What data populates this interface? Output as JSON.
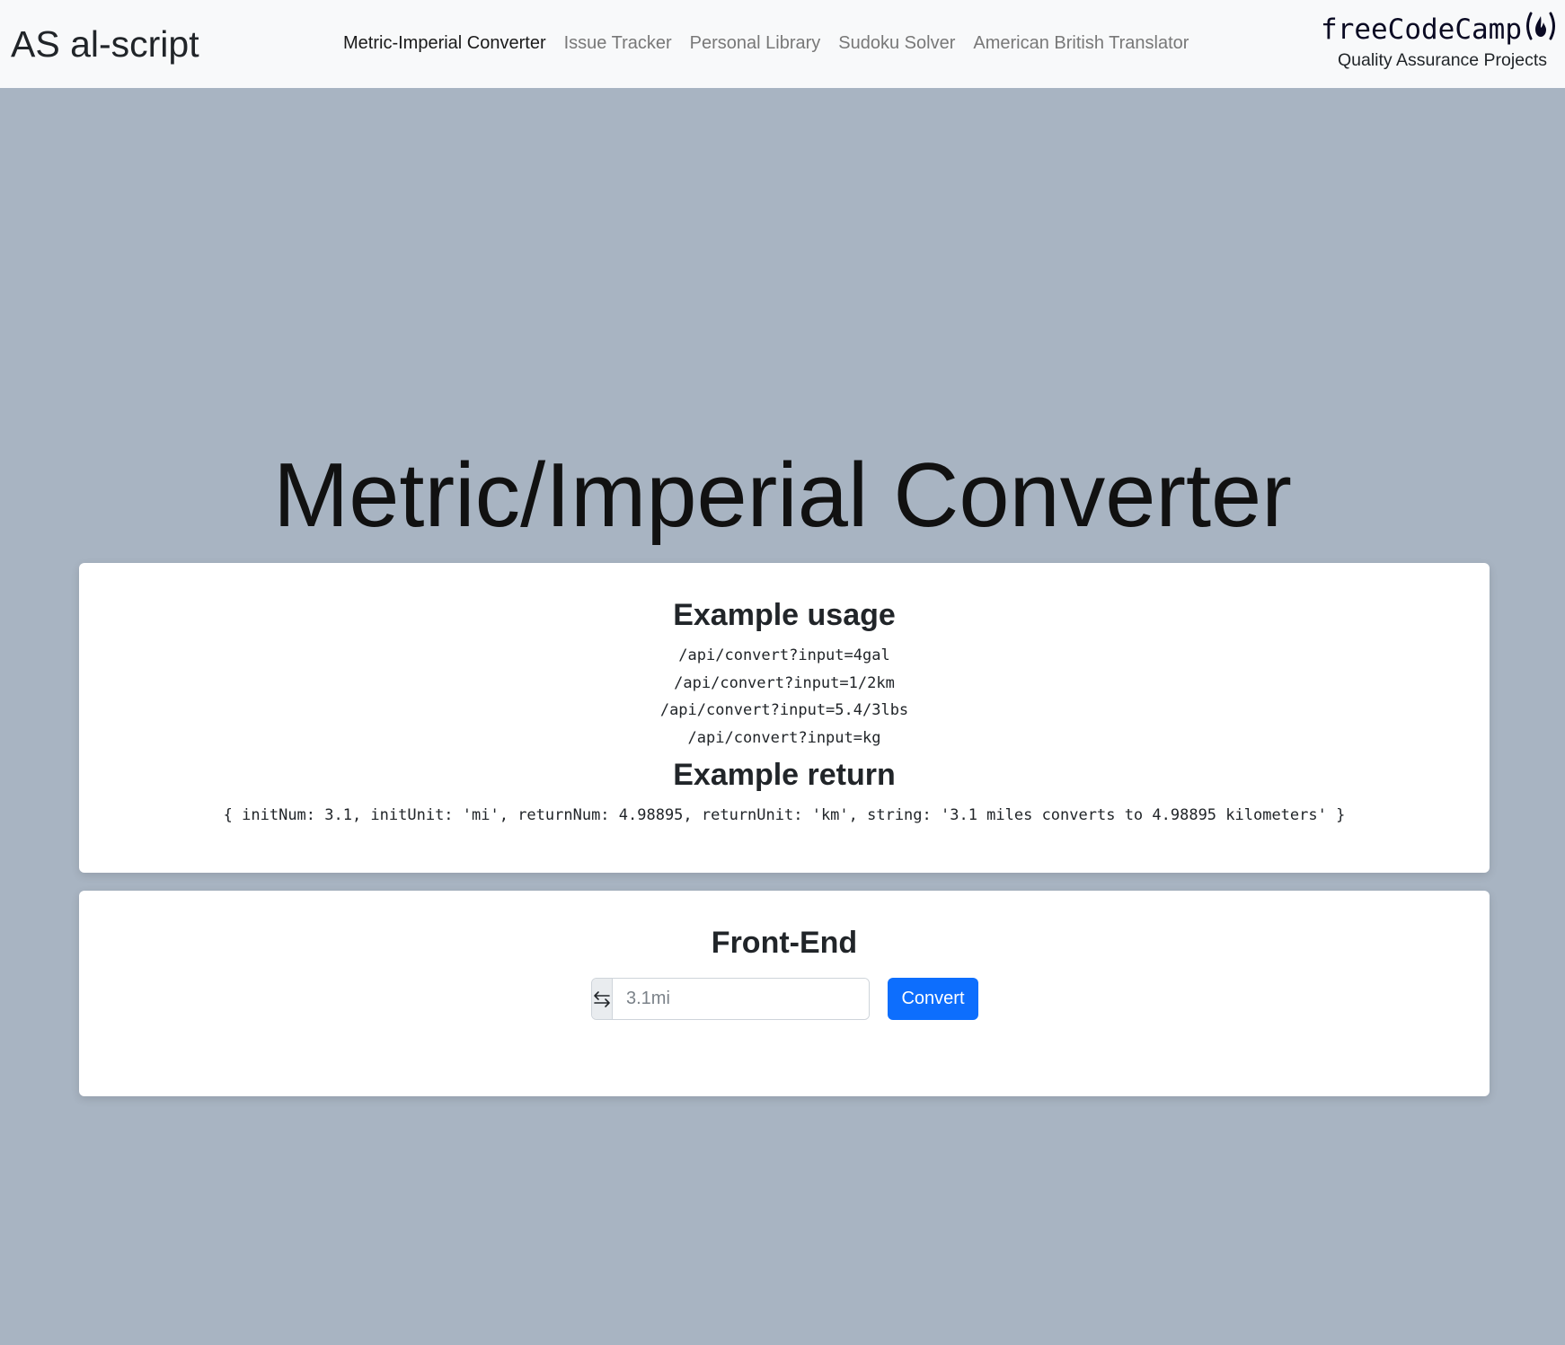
{
  "navbar": {
    "brand": "AS al-script",
    "links": [
      {
        "label": "Metric-Imperial Converter",
        "active": true
      },
      {
        "label": "Issue Tracker",
        "active": false
      },
      {
        "label": "Personal Library",
        "active": false
      },
      {
        "label": "Sudoku Solver",
        "active": false
      },
      {
        "label": "American British Translator",
        "active": false
      }
    ],
    "fcc": {
      "logo_text": "freeCodeCamp",
      "logo_icon": "fire-icon",
      "subtitle": "Quality Assurance Projects"
    }
  },
  "main": {
    "title": "Metric/Imperial Converter",
    "usage": {
      "heading": "Example usage",
      "examples": [
        "/api/convert?input=4gal",
        "/api/convert?input=1/2km",
        "/api/convert?input=5.4/3lbs",
        "/api/convert?input=kg"
      ],
      "return_heading": "Example return",
      "return_example": "{ initNum: 3.1, initUnit: 'mi', returnNum: 4.98895, returnUnit: 'km', string: '3.1 miles converts to 4.98895 kilometers' }"
    },
    "frontend": {
      "heading": "Front-End",
      "input_icon": "swap-arrows-icon",
      "input_value": "",
      "input_placeholder": "3.1mi",
      "button_label": "Convert"
    }
  },
  "colors": {
    "background": "#a8b4c2",
    "navbar": "#f8f9fa",
    "button": "#0d6efd"
  }
}
